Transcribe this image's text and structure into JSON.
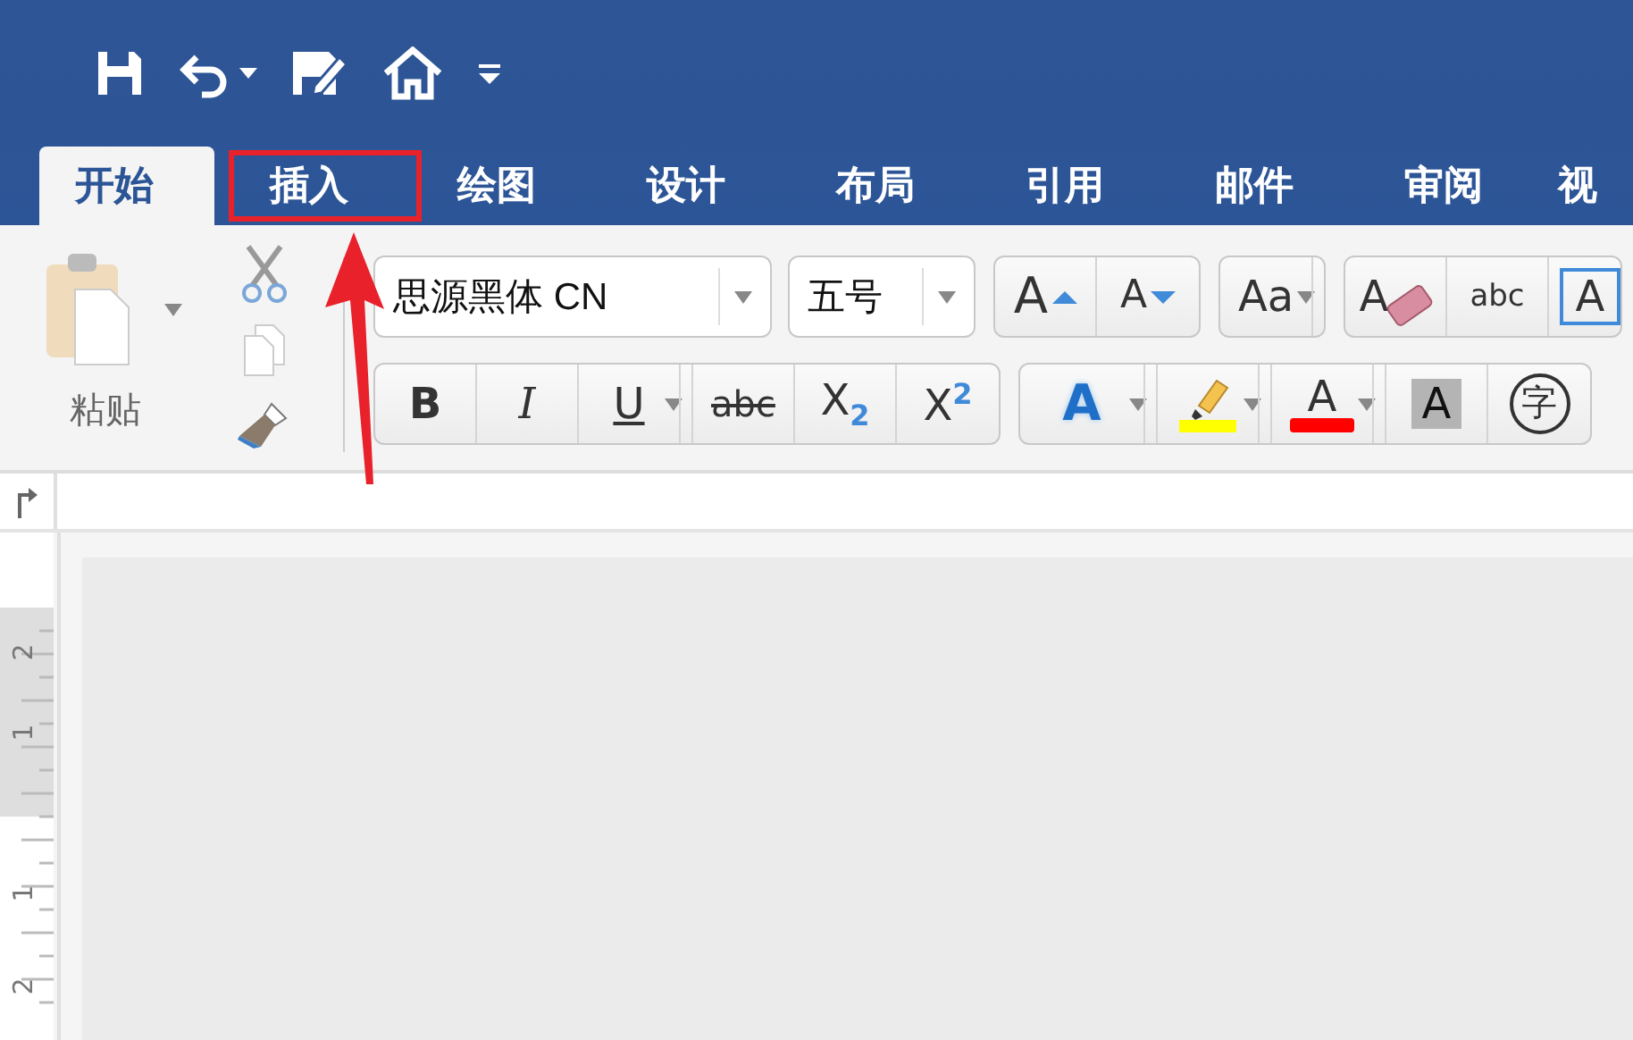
{
  "quick_access": [
    {
      "kind": "save",
      "dropdown": false
    },
    {
      "kind": "undo",
      "dropdown": true
    },
    {
      "kind": "edit",
      "dropdown": false
    },
    {
      "kind": "home",
      "dropdown": false
    },
    {
      "kind": "customize",
      "dropdown": false
    }
  ],
  "tabs": [
    {
      "label": "开始",
      "selected": true,
      "highlighted": false
    },
    {
      "label": "插入",
      "selected": false,
      "highlighted": true
    },
    {
      "label": "绘图",
      "selected": false,
      "highlighted": false
    },
    {
      "label": "设计",
      "selected": false,
      "highlighted": false
    },
    {
      "label": "布局",
      "selected": false,
      "highlighted": false
    },
    {
      "label": "引用",
      "selected": false,
      "highlighted": false
    },
    {
      "label": "邮件",
      "selected": false,
      "highlighted": false
    },
    {
      "label": "审阅",
      "selected": false,
      "highlighted": false
    },
    {
      "label": "视",
      "selected": false,
      "highlighted": false
    }
  ],
  "clipboard": {
    "paste_label": "粘贴"
  },
  "font": {
    "name": "思源黑体 CN",
    "size": "五号"
  },
  "row1_groups": [
    [
      {
        "kind": "grow",
        "text": "A",
        "dropdown": false
      },
      {
        "kind": "shrink",
        "text": "A",
        "dropdown": false
      }
    ],
    [
      {
        "kind": "change_case",
        "text": "Aa",
        "dropdown": true
      }
    ],
    [
      {
        "kind": "clear",
        "text": "A",
        "dropdown": false
      },
      {
        "kind": "phonetic",
        "text": "abc",
        "dropdown": false
      },
      {
        "kind": "boxed",
        "text": "A",
        "dropdown": false
      }
    ]
  ],
  "row2_groups": [
    [
      {
        "kind": "bold",
        "text": "B",
        "dropdown": false
      },
      {
        "kind": "italic",
        "text": "I",
        "dropdown": false
      },
      {
        "kind": "underline",
        "text": "U",
        "dropdown": true
      },
      {
        "kind": "strike",
        "text": "abc",
        "dropdown": false
      },
      {
        "kind": "script",
        "text": "X$_{2}$",
        "dropdown": false
      },
      {
        "kind": "script",
        "text": "X$^{2}$",
        "dropdown": false
      }
    ],
    [
      {
        "kind": "effects",
        "text": "A",
        "dropdown": true
      },
      {
        "kind": "highlight",
        "color": "#ffff00",
        "dropdown": true
      },
      {
        "kind": "font_color",
        "text": "A",
        "color": "#ff0000",
        "dropdown": true
      },
      {
        "kind": "shading",
        "text": "A",
        "dropdown": false
      },
      {
        "kind": "enclose",
        "text": "字",
        "dropdown": false
      }
    ]
  ],
  "ruler": {
    "numbers": [
      "2",
      "1",
      "1",
      "2"
    ]
  }
}
